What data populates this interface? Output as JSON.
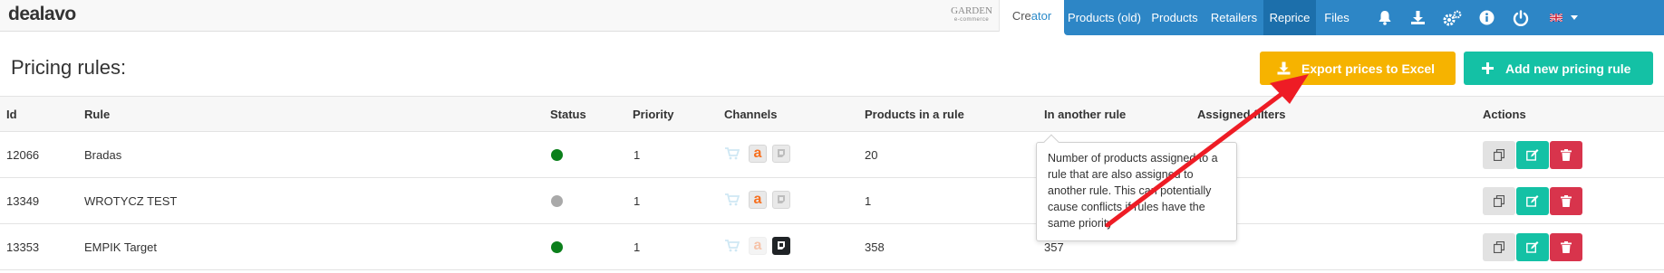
{
  "app": {
    "logo": "dealavo",
    "brand_badge": "GARDEN",
    "brand_badge_sub": "e-commerce",
    "creator_prefix": "Cre",
    "creator_suffix": "ator"
  },
  "nav": {
    "items": [
      {
        "label": "Products (old)"
      },
      {
        "label": "Products"
      },
      {
        "label": "Retailers"
      },
      {
        "label": "Reprice",
        "active": true
      },
      {
        "label": "Files"
      }
    ],
    "icons": [
      "bell-icon",
      "download-icon",
      "settings-icon",
      "info-icon",
      "power-icon",
      "uk-flag-icon",
      "caret-down-icon"
    ]
  },
  "page": {
    "title": "Pricing rules:",
    "export_label": "Export prices to Excel",
    "add_label": "Add new pricing rule"
  },
  "table": {
    "columns": [
      "Id",
      "Rule",
      "Status",
      "Priority",
      "Channels",
      "Products in a rule",
      "In another rule",
      "Assigned filters",
      "Actions"
    ],
    "rows": [
      {
        "id": "12066",
        "rule": "Bradas",
        "status": "active",
        "priority": "1",
        "products": "20",
        "in_another": "",
        "filters": ""
      },
      {
        "id": "13349",
        "rule": "WROTYCZ TEST",
        "status": "inactive",
        "priority": "1",
        "products": "1",
        "in_another": "",
        "filters": ""
      },
      {
        "id": "13353",
        "rule": "EMPIK Target",
        "status": "active",
        "priority": "1",
        "products": "358",
        "in_another": "357",
        "filters": ""
      }
    ]
  },
  "tooltip": {
    "text": "Number of products assigned to a rule that are also assigned to another rule. This can potentially cause conflicts if rules have the same priority"
  },
  "colors": {
    "nav_blue": "#2d86c6",
    "nav_active": "#1c6fab",
    "export_button": "#f6b300",
    "add_button": "#14c1a5",
    "status_active": "#0b7f1b",
    "status_inactive": "#a9a9a9",
    "delete_button": "#d8344c",
    "annotation_arrow": "#ee1c25"
  }
}
